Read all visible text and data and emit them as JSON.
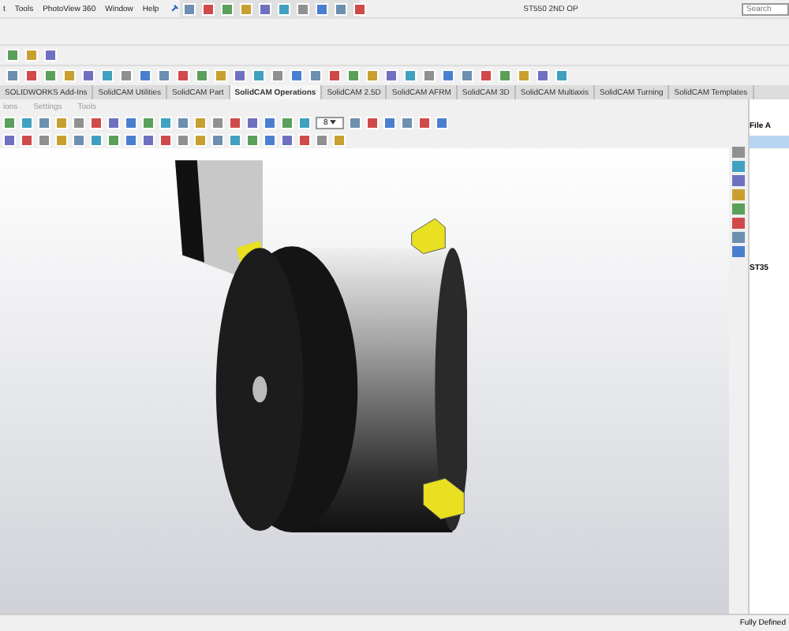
{
  "menu_bar": {
    "items": [
      "t",
      "Tools",
      "PhotoView 360",
      "Window",
      "Help"
    ]
  },
  "window": {
    "title": "ST550 2ND OP"
  },
  "search": {
    "placeholder": "Search"
  },
  "tabs": [
    {
      "label": "SOLIDWORKS Add-Ins",
      "selected": false
    },
    {
      "label": "SolidCAM Utilities",
      "selected": false
    },
    {
      "label": "SolidCAM Part",
      "selected": false
    },
    {
      "label": "SolidCAM Operations",
      "selected": true
    },
    {
      "label": "SolidCAM 2.5D",
      "selected": false
    },
    {
      "label": "SolidCAM AFRM",
      "selected": false
    },
    {
      "label": "SolidCAM 3D",
      "selected": false
    },
    {
      "label": "SolidCAM Multiaxis",
      "selected": false
    },
    {
      "label": "SolidCAM Turning",
      "selected": false
    },
    {
      "label": "SolidCAM Templates",
      "selected": false
    }
  ],
  "sub_menu": {
    "items": [
      "ions",
      "Settings",
      "Tools"
    ]
  },
  "toolbar": {
    "dropdown_value": "8"
  },
  "side_panel": {
    "header": "File A",
    "part_label": "ST35"
  },
  "status_bar": {
    "text": "Fully Defined"
  }
}
